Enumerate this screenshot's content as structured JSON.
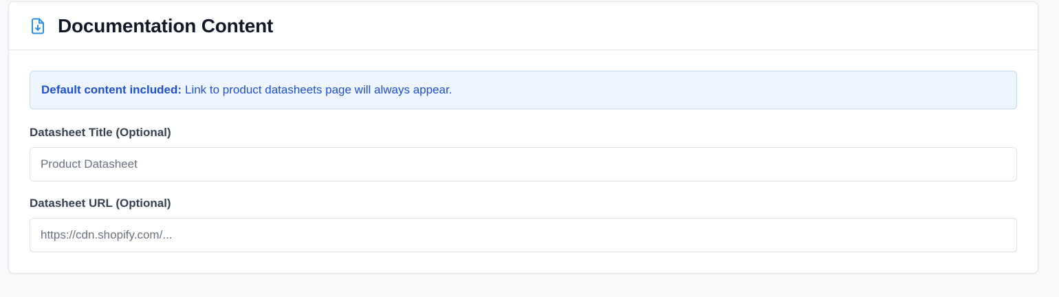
{
  "card": {
    "title": "Documentation Content",
    "icon": "file-download-icon",
    "accent_color": "#2b8ee0"
  },
  "info_banner": {
    "label": "Default content included:",
    "message": "Link to product datasheets page will always appear."
  },
  "fields": {
    "datasheet_title": {
      "label": "Datasheet Title (Optional)",
      "value": "",
      "placeholder": "Product Datasheet"
    },
    "datasheet_url": {
      "label": "Datasheet URL (Optional)",
      "value": "",
      "placeholder": "https://cdn.shopify.com/..."
    }
  }
}
